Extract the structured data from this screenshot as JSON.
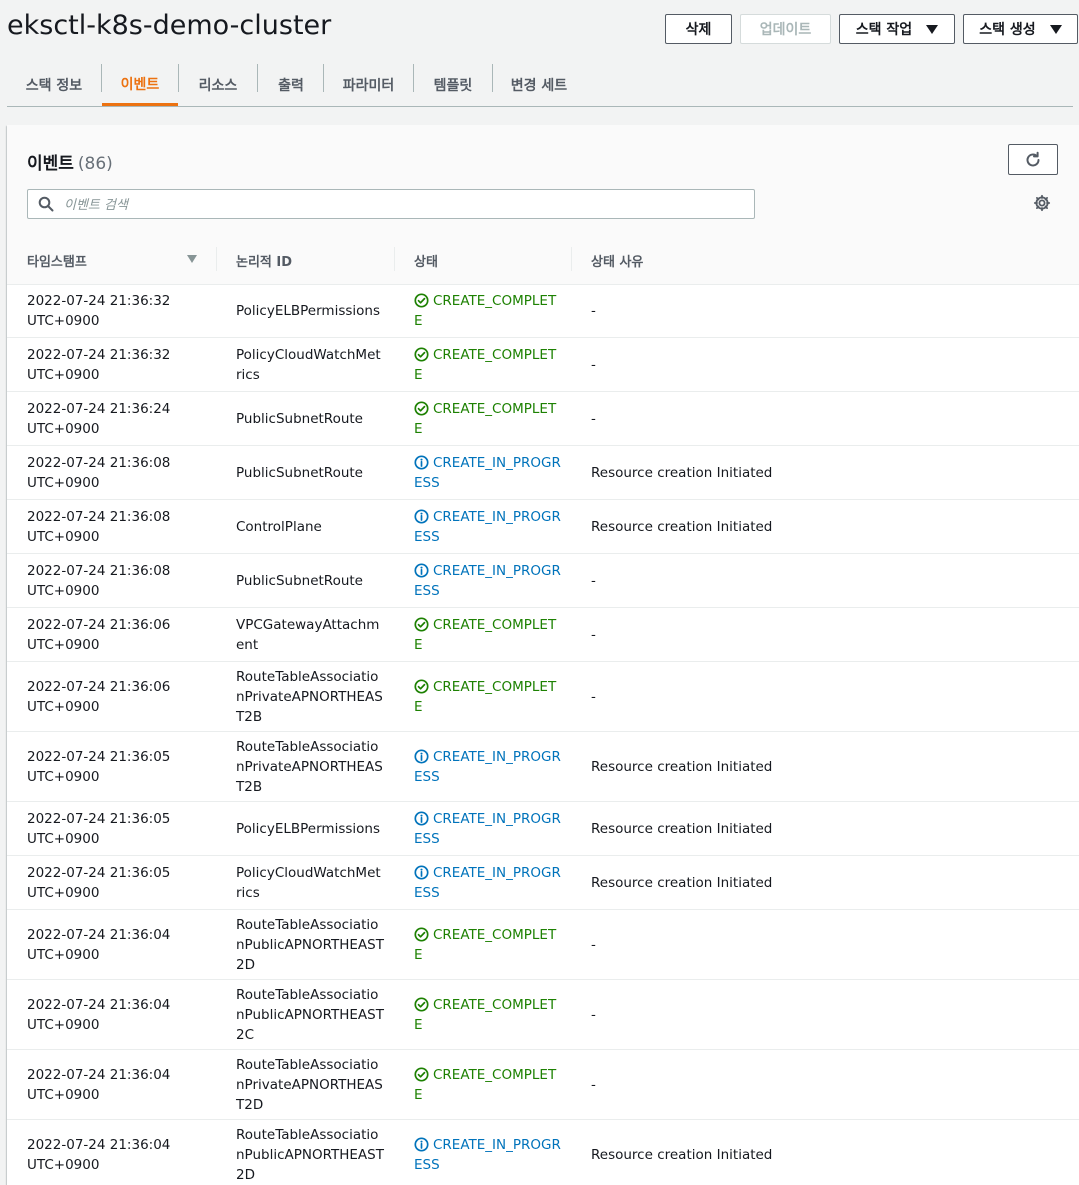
{
  "header": {
    "title": "eksctl-k8s-demo-cluster",
    "buttons": {
      "delete": "삭제",
      "update": "업데이트",
      "stack_actions": "스택 작업",
      "create_stack": "스택 생성"
    }
  },
  "tabs": [
    {
      "label": "스택 정보"
    },
    {
      "label": "이벤트"
    },
    {
      "label": "리소스"
    },
    {
      "label": "출력"
    },
    {
      "label": "파라미터"
    },
    {
      "label": "템플릿"
    },
    {
      "label": "변경 세트"
    }
  ],
  "active_tab": "이벤트",
  "events": {
    "title": "이벤트",
    "count": "(86)",
    "search_placeholder": "이벤트 검색",
    "columns": {
      "timestamp": "타임스탬프",
      "logical_id": "논리적 ID",
      "status": "상태",
      "reason": "상태 사유"
    },
    "rows": [
      {
        "ts1": "2022-07-24 21:36:32",
        "ts2": "UTC+0900",
        "id": "PolicyELBPermissions",
        "status": "CREATE_COMPLETE",
        "kind": "complete",
        "reason": "-"
      },
      {
        "ts1": "2022-07-24 21:36:32",
        "ts2": "UTC+0900",
        "id": "PolicyCloudWatchMetrics",
        "status": "CREATE_COMPLETE",
        "kind": "complete",
        "reason": "-"
      },
      {
        "ts1": "2022-07-24 21:36:24",
        "ts2": "UTC+0900",
        "id": "PublicSubnetRoute",
        "status": "CREATE_COMPLETE",
        "kind": "complete",
        "reason": "-"
      },
      {
        "ts1": "2022-07-24 21:36:08",
        "ts2": "UTC+0900",
        "id": "PublicSubnetRoute",
        "status": "CREATE_IN_PROGRESS",
        "kind": "progress",
        "reason": "Resource creation Initiated"
      },
      {
        "ts1": "2022-07-24 21:36:08",
        "ts2": "UTC+0900",
        "id": "ControlPlane",
        "status": "CREATE_IN_PROGRESS",
        "kind": "progress",
        "reason": "Resource creation Initiated"
      },
      {
        "ts1": "2022-07-24 21:36:08",
        "ts2": "UTC+0900",
        "id": "PublicSubnetRoute",
        "status": "CREATE_IN_PROGRESS",
        "kind": "progress",
        "reason": "-"
      },
      {
        "ts1": "2022-07-24 21:36:06",
        "ts2": "UTC+0900",
        "id": "VPCGatewayAttachment",
        "status": "CREATE_COMPLETE",
        "kind": "complete",
        "reason": "-"
      },
      {
        "ts1": "2022-07-24 21:36:06",
        "ts2": "UTC+0900",
        "id": "RouteTableAssociationPrivateAPNORTHEAST2B",
        "status": "CREATE_COMPLETE",
        "kind": "complete",
        "reason": "-"
      },
      {
        "ts1": "2022-07-24 21:36:05",
        "ts2": "UTC+0900",
        "id": "RouteTableAssociationPrivateAPNORTHEAST2B",
        "status": "CREATE_IN_PROGRESS",
        "kind": "progress",
        "reason": "Resource creation Initiated"
      },
      {
        "ts1": "2022-07-24 21:36:05",
        "ts2": "UTC+0900",
        "id": "PolicyELBPermissions",
        "status": "CREATE_IN_PROGRESS",
        "kind": "progress",
        "reason": "Resource creation Initiated"
      },
      {
        "ts1": "2022-07-24 21:36:05",
        "ts2": "UTC+0900",
        "id": "PolicyCloudWatchMetrics",
        "status": "CREATE_IN_PROGRESS",
        "kind": "progress",
        "reason": "Resource creation Initiated"
      },
      {
        "ts1": "2022-07-24 21:36:04",
        "ts2": "UTC+0900",
        "id": "RouteTableAssociationPublicAPNORTHEAST2D",
        "status": "CREATE_COMPLETE",
        "kind": "complete",
        "reason": "-"
      },
      {
        "ts1": "2022-07-24 21:36:04",
        "ts2": "UTC+0900",
        "id": "RouteTableAssociationPublicAPNORTHEAST2C",
        "status": "CREATE_COMPLETE",
        "kind": "complete",
        "reason": "-"
      },
      {
        "ts1": "2022-07-24 21:36:04",
        "ts2": "UTC+0900",
        "id": "RouteTableAssociationPrivateAPNORTHEAST2D",
        "status": "CREATE_COMPLETE",
        "kind": "complete",
        "reason": "-"
      },
      {
        "ts1": "2022-07-24 21:36:04",
        "ts2": "UTC+0900",
        "id": "RouteTableAssociationPublicAPNORTHEAST2D",
        "status": "CREATE_IN_PROGRESS",
        "kind": "progress",
        "reason": "Resource creation Initiated"
      }
    ]
  },
  "colors": {
    "accent": "#ec7211",
    "complete": "#1d8102",
    "progress": "#0073bb"
  }
}
